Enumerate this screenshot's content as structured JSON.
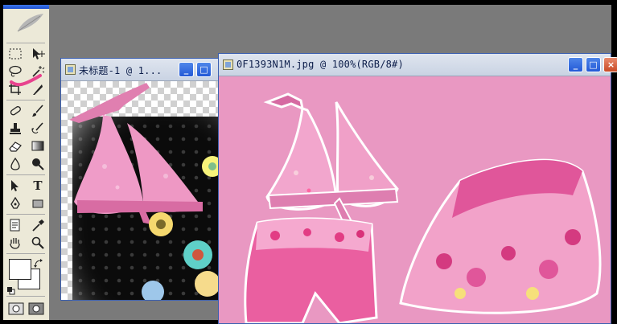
{
  "app": {
    "workspace_color": "#7a7a7a",
    "accent": "#2359d6"
  },
  "toolbox": {
    "icons": [
      "marquee-icon",
      "move-icon",
      "lasso-icon",
      "magic-wand-icon",
      "crop-icon",
      "slice-icon",
      "healing-brush-icon",
      "brush-icon",
      "clone-stamp-icon",
      "history-brush-icon",
      "eraser-icon",
      "gradient-icon",
      "blur-icon",
      "dodge-icon",
      "path-select-icon",
      "type-icon",
      "pen-icon",
      "shape-icon",
      "notes-icon",
      "eyedropper-icon",
      "hand-icon",
      "zoom-icon"
    ],
    "type_glyph": "T",
    "foreground_color": "#ffffff",
    "background_color": "#ffffff"
  },
  "windows": [
    {
      "id": "doc1",
      "title": "未标题-1 @ 1...",
      "buttons": {
        "minimize": "_",
        "maximize": "□"
      }
    },
    {
      "id": "doc2",
      "title": "0F1393N1M.jpg @ 100%(RGB/8#)",
      "buttons": {
        "minimize": "_",
        "maximize": "□",
        "close": "×"
      },
      "canvas_color": "#e998c2"
    }
  ]
}
